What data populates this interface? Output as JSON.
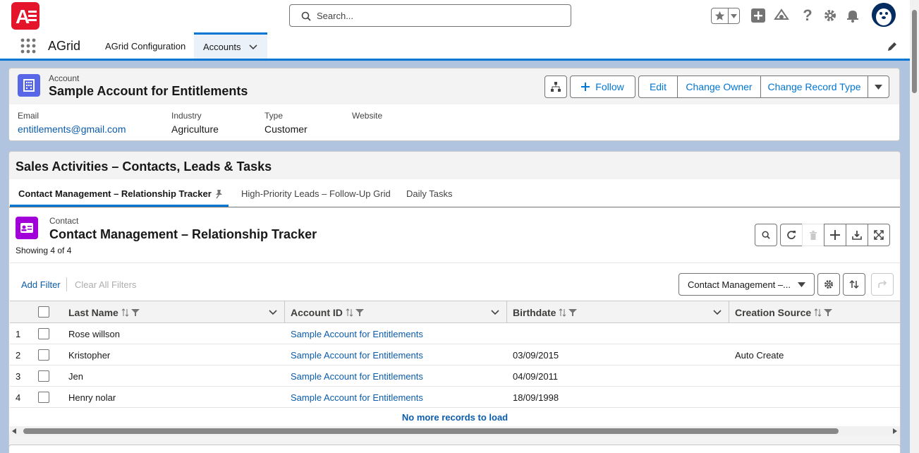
{
  "header": {
    "logo_text": "A",
    "search_placeholder": "Search..."
  },
  "nav": {
    "app_name": "AGrid",
    "items": [
      {
        "label": "AGrid Configuration"
      },
      {
        "label": "Accounts"
      }
    ]
  },
  "account": {
    "object_label": "Account",
    "name": "Sample Account for Entitlements",
    "buttons": {
      "follow": "Follow",
      "edit": "Edit",
      "change_owner": "Change Owner",
      "change_record_type": "Change Record Type"
    },
    "fields": [
      {
        "label": "Email",
        "value": "entitlements@gmail.com"
      },
      {
        "label": "Industry",
        "value": "Agriculture"
      },
      {
        "label": "Type",
        "value": "Customer"
      },
      {
        "label": "Website",
        "value": ""
      }
    ]
  },
  "panel": {
    "title": "Sales Activities – Contacts, Leads & Tasks",
    "tabs": [
      {
        "label": "Contact Management – Relationship Tracker"
      },
      {
        "label": "High-Priority Leads – Follow-Up Grid"
      },
      {
        "label": "Daily Tasks"
      }
    ]
  },
  "grid": {
    "object_label": "Contact",
    "title": "Contact Management – Relationship Tracker",
    "count": "Showing 4 of 4",
    "add_filter": "Add Filter",
    "clear_filters": "Clear All Filters",
    "view_select": "Contact Management –...",
    "columns": [
      "Last Name",
      "Account ID",
      "Birthdate",
      "Creation Source"
    ],
    "rows": [
      {
        "num": "1",
        "last_name": "Rose willson",
        "account": "Sample Account for Entitlements",
        "birthdate": "",
        "source": ""
      },
      {
        "num": "2",
        "last_name": "Kristopher",
        "account": "Sample Account for Entitlements",
        "birthdate": "03/09/2015",
        "source": "Auto Create"
      },
      {
        "num": "3",
        "last_name": "Jen",
        "account": "Sample Account for Entitlements",
        "birthdate": "04/09/2011",
        "source": ""
      },
      {
        "num": "4",
        "last_name": "Henry nolar",
        "account": "Sample Account for Entitlements",
        "birthdate": "18/09/1998",
        "source": ""
      }
    ],
    "no_more": "No more records to load"
  },
  "colors": {
    "brand_blue": "#0176d3",
    "logo_red": "#e4152b",
    "account_icon": "#5867e8",
    "contact_icon": "#a100d8"
  }
}
